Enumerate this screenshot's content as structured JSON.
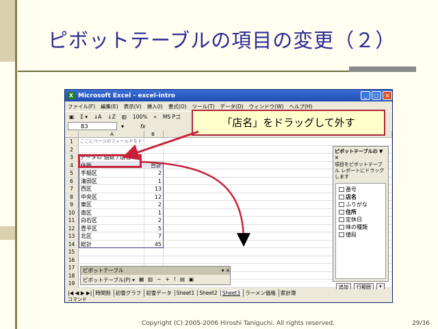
{
  "slide": {
    "title": "ピボットテーブルの項目の変更（２）",
    "copyright": "Copyright (C) 2005-2006 Hiroshi Taniguchi. All rights reserved.",
    "page": "29/36",
    "callout": "「店名」をドラッグして外す"
  },
  "excel": {
    "window_title": "Microsoft Excel - excel-intro",
    "menu": [
      "ファイル(F)",
      "編集(E)",
      "表示(V)",
      "挿入(I)",
      "書式(O)",
      "ツール(T)",
      "データ(D)",
      "ウィンドウ(W)",
      "ヘルプ(H)"
    ],
    "toolbar": {
      "zoom": "100%",
      "font": "MS Pゴ"
    },
    "namebox": "B3",
    "fx": "fx",
    "columns": [
      "A",
      "B"
    ],
    "rows": [
      {
        "n": "1",
        "a": "ここにページのフィールドをドラッグします",
        "b": ""
      },
      {
        "n": "2",
        "a": "",
        "b": ""
      },
      {
        "n": "3",
        "a": "データの 個数 / 店名",
        "b": ""
      },
      {
        "n": "4",
        "a": "住所",
        "b": "合計"
      },
      {
        "n": "5",
        "a": "手稲区",
        "b": "2"
      },
      {
        "n": "6",
        "a": "清田区",
        "b": "1"
      },
      {
        "n": "7",
        "a": "西区",
        "b": "13"
      },
      {
        "n": "8",
        "a": "中央区",
        "b": "12"
      },
      {
        "n": "9",
        "a": "東区",
        "b": "2"
      },
      {
        "n": "10",
        "a": "南区",
        "b": "1"
      },
      {
        "n": "11",
        "a": "白石区",
        "b": "2"
      },
      {
        "n": "12",
        "a": "豊平区",
        "b": "5"
      },
      {
        "n": "13",
        "a": "北区",
        "b": "7"
      },
      {
        "n": "14",
        "a": "総計",
        "b": "45"
      },
      {
        "n": "15",
        "a": "",
        "b": ""
      },
      {
        "n": "16",
        "a": "",
        "b": ""
      },
      {
        "n": "17",
        "a": "",
        "b": ""
      },
      {
        "n": "18",
        "a": "",
        "b": ""
      },
      {
        "n": "19",
        "a": "",
        "b": ""
      }
    ],
    "sheet_tabs": [
      "時間割",
      "初雪グラフ",
      "初雪データ",
      "Sheet1",
      "Sheet2",
      "Sheet3",
      "ラーメン価格",
      "家計簿"
    ],
    "status": "コマンド",
    "field_list": {
      "title": "ピボットテーブルの ▼ ×",
      "desc": "項目をピボットテーブル レポートにドラッグします",
      "fields": [
        {
          "label": "番号",
          "bold": false
        },
        {
          "label": "店名",
          "bold": true
        },
        {
          "label": "ふりがな",
          "bold": false
        },
        {
          "label": "住所",
          "bold": true
        },
        {
          "label": "定休日",
          "bold": false
        },
        {
          "label": "味の種類",
          "bold": false
        },
        {
          "label": "値段",
          "bold": false
        }
      ],
      "add_button": "追加",
      "area_select": "行範囲"
    },
    "pivot_toolbar": {
      "title": "ピボットテーブル",
      "menu": "ピボットテーブル(P) ▾"
    }
  }
}
